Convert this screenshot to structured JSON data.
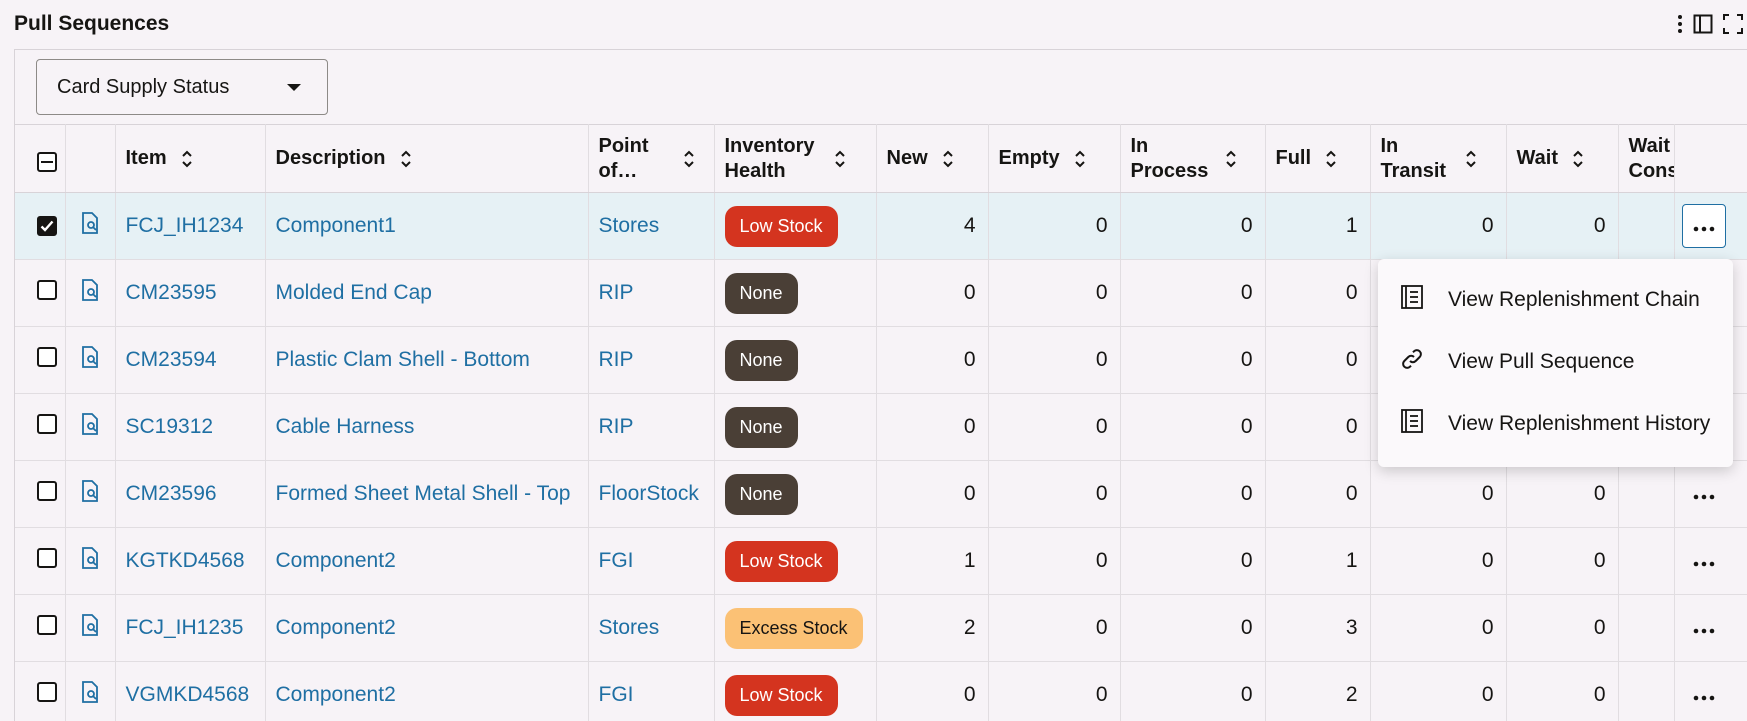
{
  "page": {
    "title": "Pull Sequences"
  },
  "toolbar": {
    "dropdown_value": "Card Supply Status"
  },
  "columns": {
    "item": "Item",
    "description": "Description",
    "point_of": "Point of…",
    "inventory_health": "Inventory Health",
    "new": "New",
    "empty": "Empty",
    "in_process": "In Process",
    "full": "Full",
    "in_transit": "In Transit",
    "wait": "Wait",
    "wait_cons": "Wait Cons"
  },
  "rows": [
    {
      "selected": true,
      "item": "FCJ_IH1234",
      "description": "Component1",
      "point": "Stores",
      "health": "Low Stock",
      "health_type": "low",
      "new": "4",
      "empty": "0",
      "in_process": "0",
      "full": "1",
      "in_transit": "0",
      "wait": "0"
    },
    {
      "selected": false,
      "item": "CM23595",
      "description": "Molded End Cap",
      "point": "RIP",
      "health": "None",
      "health_type": "none",
      "new": "0",
      "empty": "0",
      "in_process": "0",
      "full": "0",
      "in_transit": "",
      "wait": ""
    },
    {
      "selected": false,
      "item": "CM23594",
      "description": "Plastic Clam Shell - Bottom",
      "point": "RIP",
      "health": "None",
      "health_type": "none",
      "new": "0",
      "empty": "0",
      "in_process": "0",
      "full": "0",
      "in_transit": "",
      "wait": ""
    },
    {
      "selected": false,
      "item": "SC19312",
      "description": "Cable Harness",
      "point": "RIP",
      "health": "None",
      "health_type": "none",
      "new": "0",
      "empty": "0",
      "in_process": "0",
      "full": "0",
      "in_transit": "",
      "wait": ""
    },
    {
      "selected": false,
      "item": "CM23596",
      "description": "Formed Sheet Metal Shell - Top",
      "point": "FloorStock",
      "health": "None",
      "health_type": "none",
      "new": "0",
      "empty": "0",
      "in_process": "0",
      "full": "0",
      "in_transit": "0",
      "wait": "0"
    },
    {
      "selected": false,
      "item": "KGTKD4568",
      "description": "Component2",
      "point": "FGI",
      "health": "Low Stock",
      "health_type": "low",
      "new": "1",
      "empty": "0",
      "in_process": "0",
      "full": "1",
      "in_transit": "0",
      "wait": "0"
    },
    {
      "selected": false,
      "item": "FCJ_IH1235",
      "description": "Component2",
      "point": "Stores",
      "health": "Excess Stock",
      "health_type": "excess",
      "new": "2",
      "empty": "0",
      "in_process": "0",
      "full": "3",
      "in_transit": "0",
      "wait": "0"
    },
    {
      "selected": false,
      "item": "VGMKD4568",
      "description": "Component2",
      "point": "FGI",
      "health": "Low Stock",
      "health_type": "low",
      "new": "0",
      "empty": "0",
      "in_process": "0",
      "full": "2",
      "in_transit": "0",
      "wait": "0"
    }
  ],
  "menu": {
    "items": [
      {
        "label": "View Replenishment Chain",
        "icon": "document-list-icon"
      },
      {
        "label": "View Pull Sequence",
        "icon": "link-icon"
      },
      {
        "label": "View Replenishment History",
        "icon": "document-list-icon"
      }
    ]
  },
  "colors": {
    "link": "#1f6fa3",
    "low_stock": "#d4341f",
    "none": "#4a3f36",
    "excess_stock": "#fbc175",
    "selected_row": "#e6f1f5"
  }
}
